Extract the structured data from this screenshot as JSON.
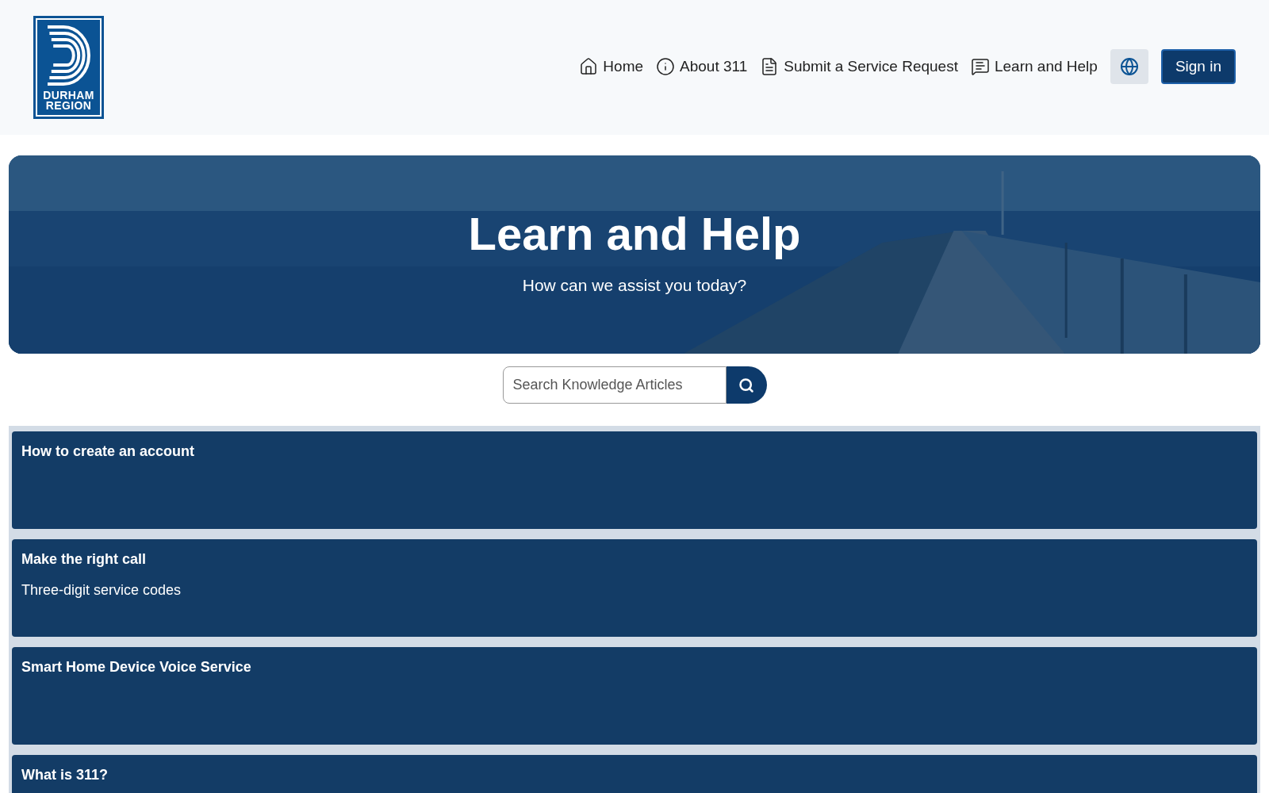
{
  "logo": {
    "lines": [
      "DURHAM",
      "REGION"
    ]
  },
  "nav": [
    {
      "label": "Home",
      "kind": "home"
    },
    {
      "label": "About 311",
      "kind": "info"
    },
    {
      "label": "Submit a Service Request",
      "kind": "document"
    },
    {
      "label": "Learn and Help",
      "kind": "chat"
    }
  ],
  "sign_in": "Sign in",
  "hero": {
    "title": "Learn and Help",
    "subtitle": "How can we assist you today?"
  },
  "search": {
    "placeholder": "Search Knowledge Articles"
  },
  "articles": [
    {
      "title": "How to create an account"
    },
    {
      "title": "Make the right call",
      "description": "Three-digit service codes"
    },
    {
      "title": "Smart Home Device Voice Service"
    },
    {
      "title": "What is 311?"
    }
  ]
}
